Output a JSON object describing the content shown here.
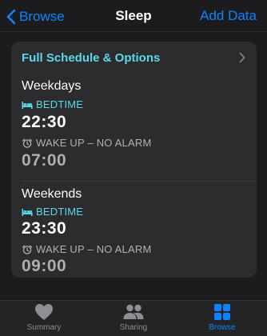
{
  "nav": {
    "back_label": "Browse",
    "title": "Sleep",
    "action_label": "Add Data"
  },
  "card": {
    "header": "Full Schedule & Options",
    "weekdays": {
      "title": "Weekdays",
      "bedtime_label": "BEDTIME",
      "bedtime": "22:30",
      "wake_label": "WAKE UP – NO ALARM",
      "wake": "07:00"
    },
    "weekends": {
      "title": "Weekends",
      "bedtime_label": "BEDTIME",
      "bedtime": "23:30",
      "wake_label": "WAKE UP – NO ALARM",
      "wake": "09:00"
    }
  },
  "tabs": [
    {
      "label": "Summary",
      "icon": "heart-icon",
      "active": false
    },
    {
      "label": "Sharing",
      "icon": "people-icon",
      "active": false
    },
    {
      "label": "Browse",
      "icon": "grid-icon",
      "active": true
    }
  ],
  "colors": {
    "accent": "#0a84ff",
    "sleep": "#5ad8e6",
    "background": "#1c1c1e",
    "card": "#2c2c2e"
  }
}
